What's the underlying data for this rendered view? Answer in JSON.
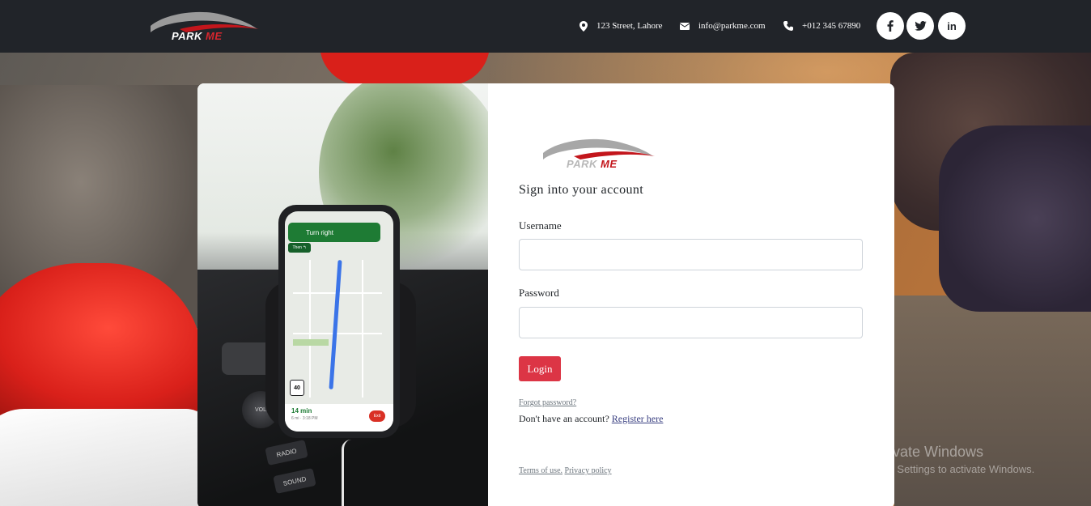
{
  "header": {
    "logo": {
      "text_part1": "PARK",
      "text_part2": "ME"
    },
    "contact": {
      "address": "123 Street, Lahore",
      "email": "info@parkme.com",
      "phone": "+012 345 67890",
      "address_icon": "map-marker-icon",
      "email_icon": "envelope-icon",
      "phone_icon": "phone-icon"
    },
    "social": {
      "facebook_icon": "facebook-icon",
      "twitter_icon": "twitter-icon",
      "linkedin_icon": "linkedin-icon",
      "linkedin_glyph": "in"
    }
  },
  "photo": {
    "nav_instruction": "Turn right",
    "nav_then": "Then ↰",
    "speed": "40",
    "eta": "14 min",
    "eta_sub": "6 mi · 3:18 PM",
    "exit": "Exit",
    "vol": "VOL",
    "radio": "RADIO",
    "sound": "SOUND"
  },
  "form": {
    "logo": {
      "text_part1": "PARK",
      "text_part2": "ME"
    },
    "title": "Sign into your account",
    "username_label": "Username",
    "username_value": "",
    "password_label": "Password",
    "password_value": "",
    "login_button": "Login",
    "forgot_link": "Forgot password?",
    "no_account_text": "Don't have an account?",
    "register_link": "Register here",
    "terms_link": "Terms of use.",
    "privacy_link": "Privacy policy"
  },
  "watermark": {
    "line1": "Activate Windows",
    "line2": "Go to Settings to activate Windows."
  },
  "colors": {
    "topbar": "#212429",
    "accent": "#dc3545",
    "link": "#393f81",
    "muted": "#6c757d"
  }
}
